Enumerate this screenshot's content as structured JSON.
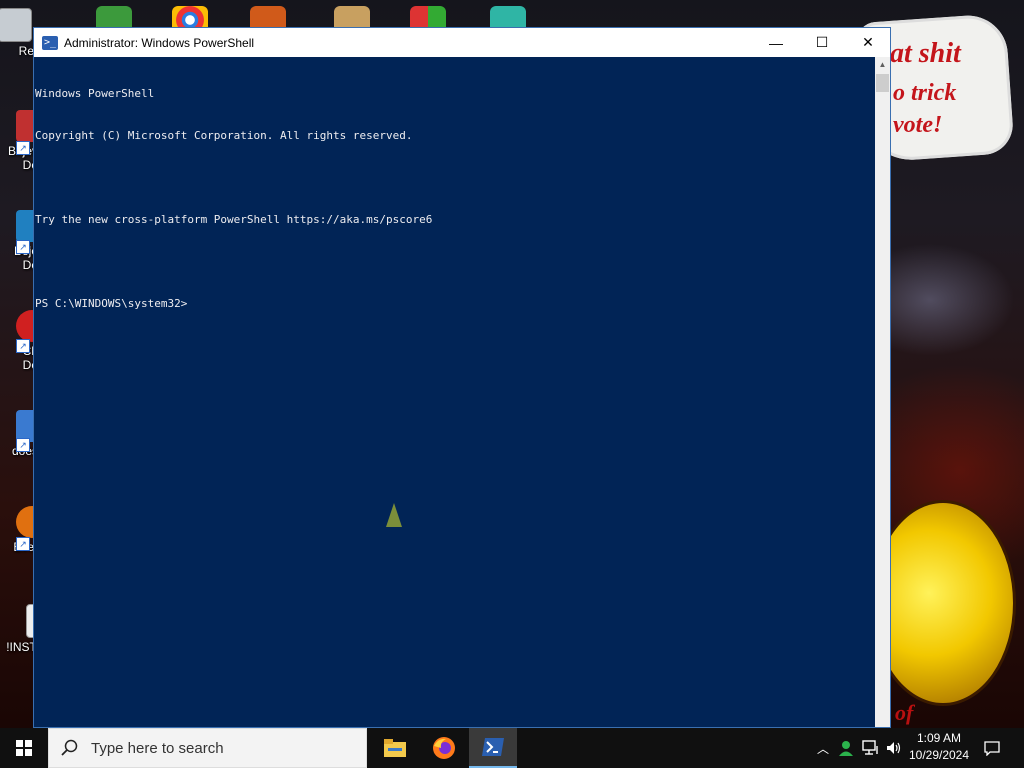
{
  "desktop": {
    "icons": [
      {
        "label": "Recy",
        "name": "recycle-bin-icon"
      },
      {
        "label": "Bejev\nDe",
        "name": "bejeweled-icon"
      },
      {
        "label": "Beje\nDe",
        "name": "bejeweled-2-icon"
      },
      {
        "label": "Ch\nDe",
        "name": "chuzzle-icon"
      },
      {
        "label": "does",
        "name": "does-icon"
      },
      {
        "label": "Ever",
        "name": "ever-icon"
      },
      {
        "label": "!INSTA",
        "name": "install-icon"
      }
    ],
    "wallpaper_sign_lines": [
      "at shit",
      "o trick",
      "vote!"
    ],
    "wallpaper_bottom_text": "of"
  },
  "window": {
    "title": "Administrator: Windows PowerShell",
    "minimize_glyph": "—",
    "maximize_glyph": "☐",
    "close_glyph": "✕",
    "console_lines": [
      "Windows PowerShell",
      "Copyright (C) Microsoft Corporation. All rights reserved.",
      "",
      "Try the new cross-platform PowerShell https://aka.ms/pscore6",
      "",
      "PS C:\\WINDOWS\\system32>"
    ],
    "colors": {
      "console_bg": "#012456",
      "console_fg": "#eeedf0"
    }
  },
  "taskbar": {
    "search_placeholder": "Type here to search",
    "apps": [
      {
        "name": "file-explorer-icon",
        "active": false
      },
      {
        "name": "firefox-icon",
        "active": false
      },
      {
        "name": "powershell-icon",
        "active": true
      }
    ],
    "clock_time": "1:09 AM",
    "clock_date": "10/29/2024"
  }
}
